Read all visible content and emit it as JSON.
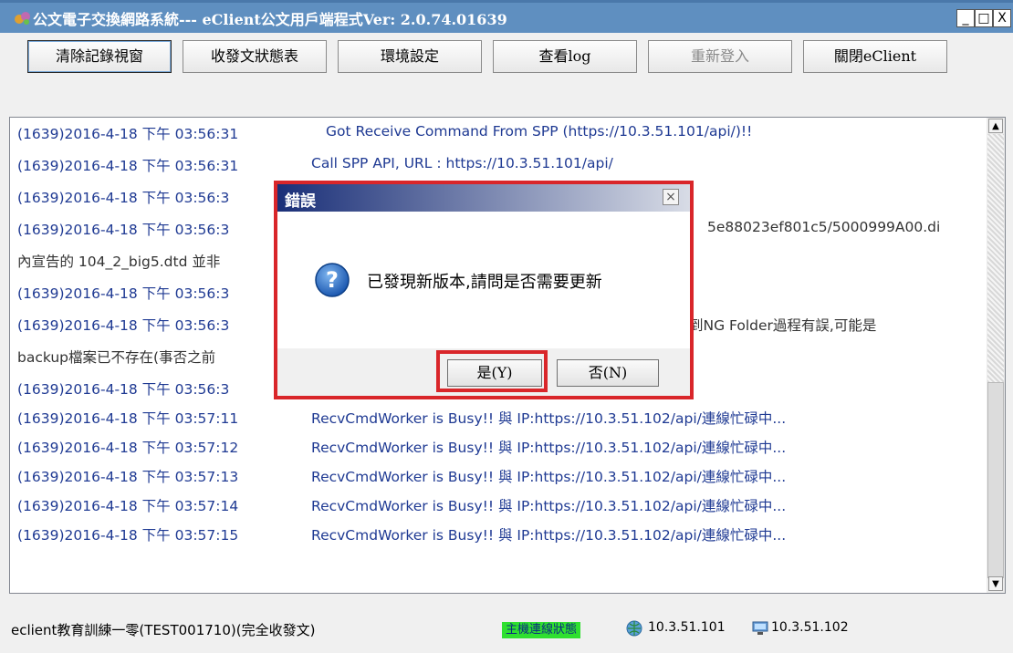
{
  "window": {
    "title": "公文電子交換網路系統--- eClient公文用戶端程式Ver: 2.0.74.01639",
    "min_glyph": "_",
    "max_glyph": "□",
    "close_glyph": "X"
  },
  "toolbar": {
    "buttons": [
      {
        "label": "清除記錄視窗",
        "enabled": true
      },
      {
        "label": "收發文狀態表",
        "enabled": true
      },
      {
        "label": "環境設定",
        "enabled": true
      },
      {
        "label": "查看log",
        "enabled": true
      },
      {
        "label": "重新登入",
        "enabled": false
      },
      {
        "label": "關閉eClient",
        "enabled": true
      }
    ]
  },
  "log": {
    "lines": [
      {
        "ts": "(1639)2016-4-18 下午 03:56:31",
        "msg": "Got Receive Command From SPP (https://10.3.51.101/api/)!!"
      },
      {
        "ts": "(1639)2016-4-18 下午 03:56:31",
        "msg": "Call SPP API, URL : https://10.3.51.101/api/"
      },
      {
        "ts": "(1639)2016-4-18 下午 03:56:3",
        "msg": ""
      },
      {
        "ts": "(1639)2016-4-18 下午 03:56:3",
        "msg": "5e88023ef801c5/5000999A00.di"
      },
      {
        "ts": "內宣告的 104_2_big5.dtd 並非",
        "msg": ""
      },
      {
        "ts": "(1639)2016-4-18 下午 03:56:3",
        "msg": ""
      },
      {
        "ts": "(1639)2016-4-18 下午 03:56:3",
        "msg": "到NG Folder過程有誤,可能是"
      },
      {
        "ts": "backup檔案已不存在(事否之前",
        "msg": ""
      },
      {
        "ts": "(1639)2016-4-18 下午 03:56:3",
        "msg": ""
      },
      {
        "ts": "(1639)2016-4-18 下午 03:57:11",
        "msg": "RecvCmdWorker is Busy!! 與 IP:https://10.3.51.102/api/連線忙碌中..."
      },
      {
        "ts": "(1639)2016-4-18 下午 03:57:12",
        "msg": "RecvCmdWorker is Busy!! 與 IP:https://10.3.51.102/api/連線忙碌中..."
      },
      {
        "ts": "(1639)2016-4-18 下午 03:57:13",
        "msg": "RecvCmdWorker is Busy!! 與 IP:https://10.3.51.102/api/連線忙碌中..."
      },
      {
        "ts": "(1639)2016-4-18 下午 03:57:14",
        "msg": "RecvCmdWorker is Busy!! 與 IP:https://10.3.51.102/api/連線忙碌中..."
      },
      {
        "ts": "(1639)2016-4-18 下午 03:57:15",
        "msg": "RecvCmdWorker is Busy!! 與 IP:https://10.3.51.102/api/連線忙碌中..."
      }
    ]
  },
  "status": {
    "user": "eclient教育訓練一零(TEST001710)(完全收發文)",
    "connection_badge": "主機連線狀態",
    "ip1": "10.3.51.101",
    "ip2": "10.3.51.102"
  },
  "dialog": {
    "title": "錯誤",
    "message": "已發現新版本,請問是否需要更新",
    "yes_label": "是(Y)",
    "no_label": "否(N)",
    "close_glyph": "×"
  },
  "colors": {
    "titlebar": "#5f8fc0",
    "highlight_red": "#d9262a",
    "log_text": "#1f3a93",
    "status_green": "#2fe02f"
  }
}
